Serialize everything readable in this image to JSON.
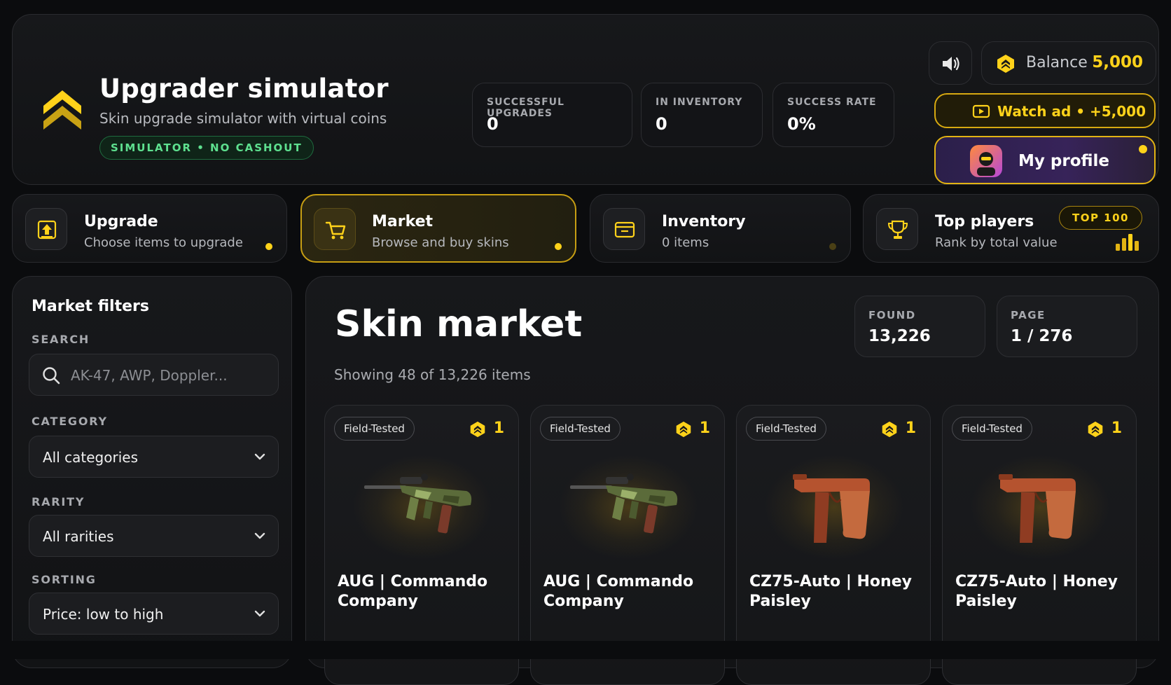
{
  "header": {
    "title": "Upgrader simulator",
    "subtitle": "Skin upgrade simulator with virtual coins",
    "badge": "SIMULATOR • NO CASHOUT",
    "stats": [
      {
        "label": "SUCCESSFUL UPGRADES",
        "value": "0"
      },
      {
        "label": "IN INVENTORY",
        "value": "0"
      },
      {
        "label": "SUCCESS RATE",
        "value": "0%"
      }
    ],
    "balance_label": "Balance",
    "balance_value": "5,000",
    "watch_ad_label": "Watch ad • +5,000",
    "profile_label": "My profile",
    "icons": {
      "sound": "speaker-icon",
      "coin": "coin-icon",
      "video": "video-icon",
      "logo": "chevron-logo"
    },
    "accent_color": "#ffd21a"
  },
  "nav": [
    {
      "title": "Upgrade",
      "subtitle": "Choose items to upgrade",
      "icon": "upgrade-icon"
    },
    {
      "title": "Market",
      "subtitle": "Browse and buy skins",
      "icon": "cart-icon",
      "active": true
    },
    {
      "title": "Inventory",
      "subtitle": "0 items",
      "icon": "inventory-icon"
    },
    {
      "title": "Top players",
      "subtitle": "Rank by total value",
      "icon": "trophy-icon",
      "badge": "TOP 100"
    }
  ],
  "filters": {
    "title": "Market filters",
    "search_label": "SEARCH",
    "search_placeholder": "AK-47, AWP, Doppler...",
    "category_label": "CATEGORY",
    "category_value": "All categories",
    "rarity_label": "RARITY",
    "rarity_value": "All rarities",
    "sorting_label": "SORTING",
    "sorting_value": "Price: low to high"
  },
  "market": {
    "title": "Skin market",
    "showing": "Showing 48 of 13,226 items",
    "found_label": "FOUND",
    "found_value": "13,226",
    "page_label": "PAGE",
    "page_value": "1 / 276",
    "items": [
      {
        "condition": "Field-Tested",
        "price": "1",
        "name": "AUG | Commando Company",
        "weapon": "aug"
      },
      {
        "condition": "Field-Tested",
        "price": "1",
        "name": "AUG | Commando Company",
        "weapon": "aug"
      },
      {
        "condition": "Field-Tested",
        "price": "1",
        "name": "CZ75-Auto | Honey Paisley",
        "weapon": "cz75"
      },
      {
        "condition": "Field-Tested",
        "price": "1",
        "name": "CZ75-Auto | Honey Paisley",
        "weapon": "cz75"
      }
    ]
  }
}
